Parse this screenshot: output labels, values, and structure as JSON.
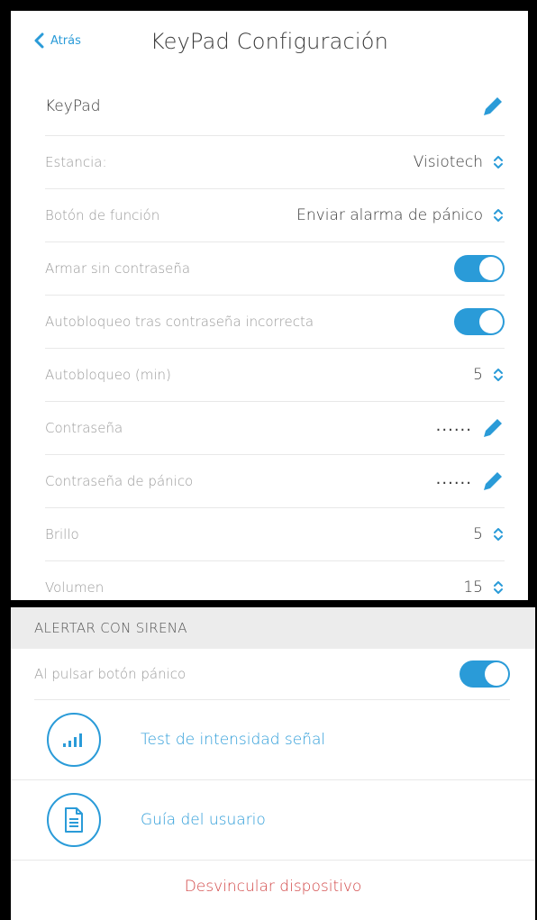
{
  "navbar": {
    "back_label": "Atrás",
    "title": "KeyPad Configuración"
  },
  "device": {
    "name": "KeyPad"
  },
  "settings": {
    "room_label": "Estancia:",
    "room_value": "Visiotech",
    "function_button_label": "Botón de función",
    "function_button_value": "Enviar alarma de pánico",
    "arm_without_password_label": "Armar sin contraseña",
    "arm_without_password_on": true,
    "autolock_incorrect_label": "Autobloqueo tras contraseña incorrecta",
    "autolock_incorrect_on": true,
    "autolock_min_label": "Autobloqueo (min)",
    "autolock_min_value": "5",
    "password_label": "Contraseña",
    "password_mask": "......",
    "panic_password_label": "Contraseña de pánico",
    "panic_password_mask": "......",
    "brightness_label": "Brillo",
    "brightness_value": "5",
    "volume_label": "Volumen",
    "volume_value": "15"
  },
  "siren": {
    "section_title": "ALERTAR CON SIRENA",
    "panic_button_label": "Al pulsar botón pánico",
    "panic_button_on": true
  },
  "actions": {
    "signal_test_label": "Test de intensidad señal",
    "user_guide_label": "Guía del usuario",
    "unlink_label": "Desvincular dispositivo"
  },
  "colors": {
    "accent": "#2a9bd8",
    "danger": "#d24848",
    "section_bg": "#ececec"
  },
  "icons": [
    "chevron-left-icon",
    "pencil-icon",
    "up-down-chevron-icon",
    "signal-bars-icon",
    "document-icon"
  ]
}
